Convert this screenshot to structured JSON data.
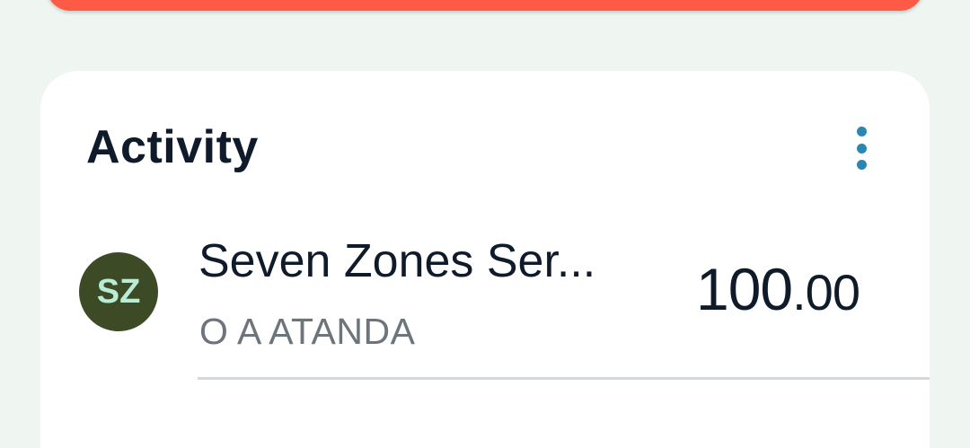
{
  "activity": {
    "title": "Activity",
    "menu_icon": "more-vertical-icon",
    "accent_color": "#2b86b2",
    "transactions": [
      {
        "avatar_initials": "SZ",
        "name": "Seven Zones Ser...",
        "subtitle": "O A ATANDA",
        "amount_whole": "100",
        "amount_cents": ".00"
      }
    ]
  },
  "colors": {
    "banner": "#ff5a46",
    "background": "#eff5f0",
    "avatar_bg": "#3c4a26",
    "avatar_text": "#b8ecd4"
  }
}
